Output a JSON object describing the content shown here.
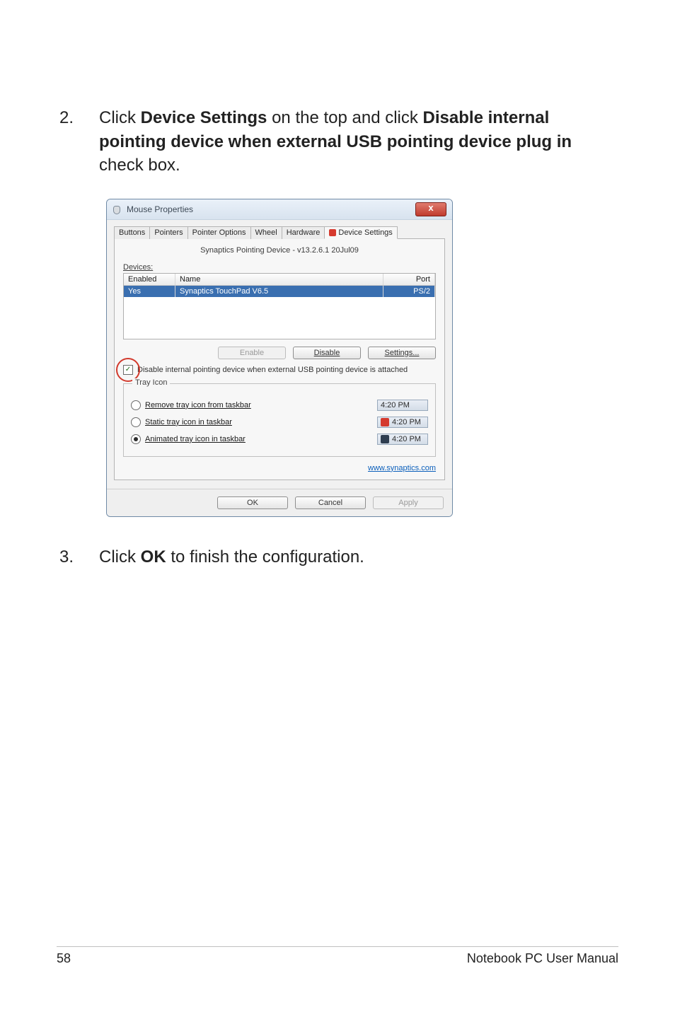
{
  "steps": {
    "s2": {
      "num": "2.",
      "before": "Click ",
      "b1": "Device Settings",
      "mid1": " on the top and click ",
      "b2": "Disable internal pointing device when external USB pointing device plug in",
      "after": " check box."
    },
    "s3": {
      "num": "3.",
      "before": "Click ",
      "b1": "OK",
      "after": " to finish the configuration."
    }
  },
  "dialog": {
    "title": "Mouse Properties",
    "close_glyph": "x",
    "tabs": [
      "Buttons",
      "Pointers",
      "Pointer Options",
      "Wheel",
      "Hardware",
      "Device Settings"
    ],
    "driver_line": "Synaptics Pointing Device - v13.2.6.1 20Jul09",
    "devices_label": "Devices:",
    "devices": {
      "headers": {
        "enabled": "Enabled",
        "name": "Name",
        "port": "Port"
      },
      "row": {
        "enabled": "Yes",
        "name": "Synaptics TouchPad V6.5",
        "port": "PS/2"
      }
    },
    "buttons": {
      "enable": "Enable",
      "disable": "Disable",
      "settings": "Settings..."
    },
    "checkbox_label": "Disable internal pointing device when external USB pointing device is attached",
    "tray": {
      "legend": "Tray Icon",
      "opt_remove": "Remove tray icon from taskbar",
      "opt_static": "Static tray icon in taskbar",
      "opt_animated": "Animated tray icon in taskbar",
      "time": "4:20 PM"
    },
    "link": "www.synaptics.com",
    "dlg_buttons": {
      "ok": "OK",
      "cancel": "Cancel",
      "apply": "Apply"
    }
  },
  "footer": {
    "page": "58",
    "book": "Notebook PC User Manual"
  }
}
